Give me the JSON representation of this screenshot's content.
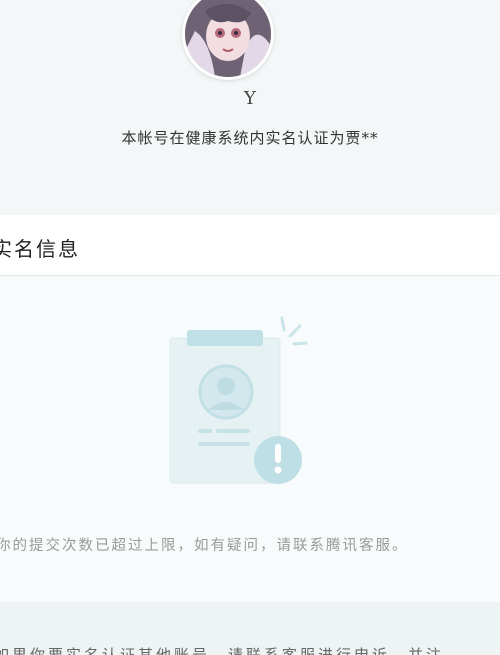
{
  "profile": {
    "nickname": "Y",
    "verify_text": "本帐号在健康系统内实名认证为贾**"
  },
  "section": {
    "title": "实名信息"
  },
  "empty_state": {
    "notice": "你的提交次数已超过上限，如有疑问，请联系腾讯客服。"
  },
  "footer": {
    "text": "如果你要实名认证其他账号，请联系客服进行申诉，并注"
  },
  "colors": {
    "background": "#f3f7f7",
    "card": "#ffffff",
    "illus_accent": "#bfe0e6",
    "notice_text": "#9a9a9a"
  }
}
